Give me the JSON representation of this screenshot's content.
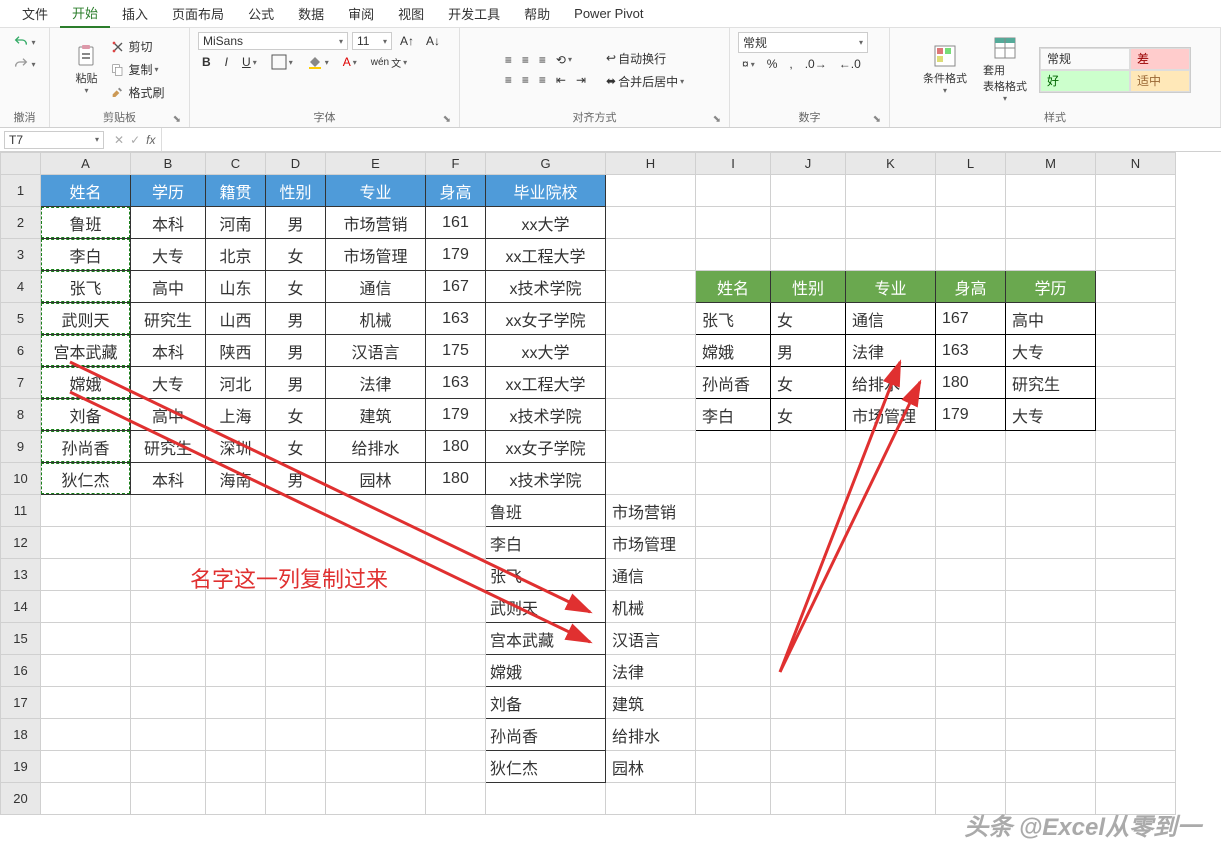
{
  "menu": {
    "file": "文件",
    "home": "开始",
    "insert": "插入",
    "layout": "页面布局",
    "formula": "公式",
    "data": "数据",
    "review": "审阅",
    "view": "视图",
    "dev": "开发工具",
    "help": "帮助",
    "pivot": "Power Pivot"
  },
  "ribbon": {
    "undo": "撤消",
    "paste": "粘贴",
    "cut": "剪切",
    "copy": "复制",
    "painter": "格式刷",
    "clipboard": "剪贴板",
    "fontName": "MiSans",
    "fontSize": "11",
    "fontGroup": "字体",
    "alignGroup": "对齐方式",
    "wrap": "自动换行",
    "merge": "合并后居中",
    "numFormat": "常规",
    "numGroup": "数字",
    "condFmt": "条件格式",
    "tableFmt": "套用\n表格格式",
    "normal": "常规",
    "bad": "差",
    "good": "好",
    "neutral": "适中",
    "styleGroup": "样式"
  },
  "nameBox": "T7",
  "cols": [
    "A",
    "B",
    "C",
    "D",
    "E",
    "F",
    "G",
    "H",
    "I",
    "J",
    "K",
    "L",
    "M",
    "N"
  ],
  "table1": {
    "headers": [
      "姓名",
      "学历",
      "籍贯",
      "性别",
      "专业",
      "身高",
      "毕业院校"
    ],
    "rows": [
      [
        "鲁班",
        "本科",
        "河南",
        "男",
        "市场营销",
        "161",
        "xx大学"
      ],
      [
        "李白",
        "大专",
        "北京",
        "女",
        "市场管理",
        "179",
        "xx工程大学"
      ],
      [
        "张飞",
        "高中",
        "山东",
        "女",
        "通信",
        "167",
        "x技术学院"
      ],
      [
        "武则天",
        "研究生",
        "山西",
        "男",
        "机械",
        "163",
        "xx女子学院"
      ],
      [
        "宫本武藏",
        "本科",
        "陕西",
        "男",
        "汉语言",
        "175",
        "xx大学"
      ],
      [
        "嫦娥",
        "大专",
        "河北",
        "男",
        "法律",
        "163",
        "xx工程大学"
      ],
      [
        "刘备",
        "高中",
        "上海",
        "女",
        "建筑",
        "179",
        "x技术学院"
      ],
      [
        "孙尚香",
        "研究生",
        "深圳",
        "女",
        "给排水",
        "180",
        "xx女子学院"
      ],
      [
        "狄仁杰",
        "本科",
        "海南",
        "男",
        "园林",
        "180",
        "x技术学院"
      ]
    ]
  },
  "table2": {
    "headers": [
      "姓名",
      "性别",
      "专业",
      "身高",
      "学历"
    ],
    "rows": [
      [
        "张飞",
        "女",
        "通信",
        "167",
        "高中"
      ],
      [
        "嫦娥",
        "男",
        "法律",
        "163",
        "大专"
      ],
      [
        "孙尚香",
        "女",
        "给排水",
        "180",
        "研究生"
      ],
      [
        "李白",
        "女",
        "市场管理",
        "179",
        "大专"
      ]
    ]
  },
  "table3": {
    "rows": [
      [
        "鲁班",
        "市场营销"
      ],
      [
        "李白",
        "市场管理"
      ],
      [
        "张飞",
        "通信"
      ],
      [
        "武则天",
        "机械"
      ],
      [
        "宫本武藏",
        "汉语言"
      ],
      [
        "嫦娥",
        "法律"
      ],
      [
        "刘备",
        "建筑"
      ],
      [
        "孙尚香",
        "给排水"
      ],
      [
        "狄仁杰",
        "园林"
      ]
    ]
  },
  "annotation": "名字这一列复制过来",
  "watermark": "头条 @Excel从零到一"
}
